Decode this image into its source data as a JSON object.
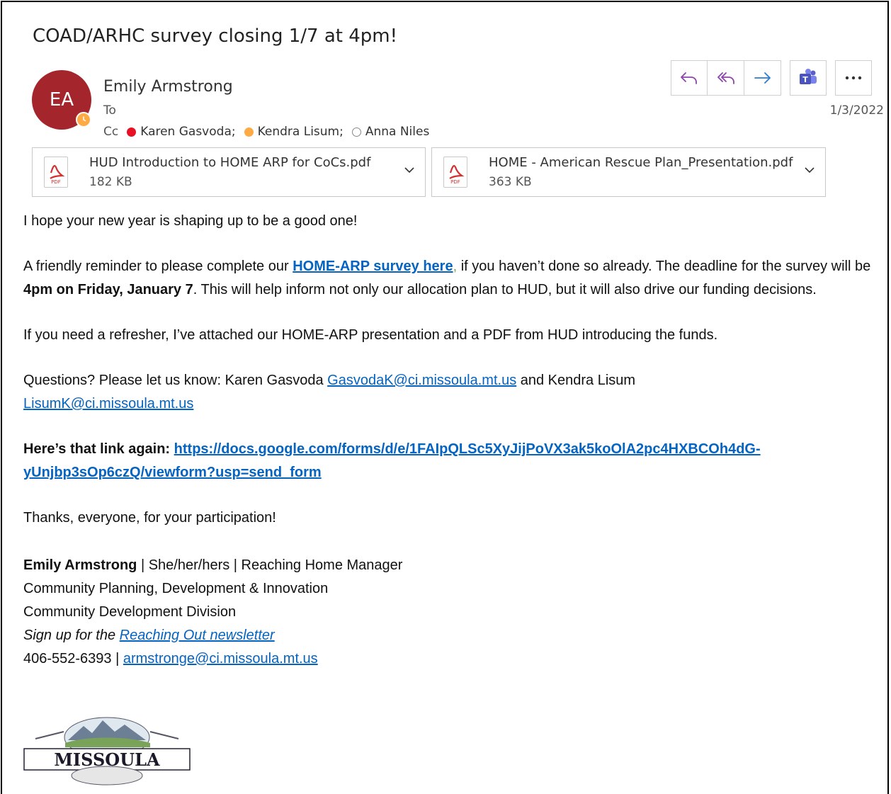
{
  "subject": "COAD/ARHC survey closing 1/7 at 4pm!",
  "sender": {
    "initials": "EA",
    "name": "Emily Armstrong",
    "avatar_color": "#a4262c",
    "presence_color": "#ffaa44"
  },
  "to_label": "To",
  "cc_label": "Cc",
  "cc": [
    {
      "name": "Karen Gasvoda;",
      "status": "busy",
      "color": "#e81123"
    },
    {
      "name": "Kendra Lisum;",
      "status": "away",
      "color": "#ffaa44"
    },
    {
      "name": "Anna Niles",
      "status": "offline",
      "color": "#ffffff"
    }
  ],
  "date": "1/3/2022",
  "toolbar": {
    "reply_icon": "reply-icon",
    "reply_all_icon": "reply-all-icon",
    "forward_icon": "forward-icon",
    "teams_icon": "teams-icon",
    "more_icon": "more-icon"
  },
  "attachments": [
    {
      "name": "HUD Introduction to HOME ARP for CoCs.pdf",
      "size": "182 KB",
      "type_label": "PDF"
    },
    {
      "name": "HOME - American Rescue Plan_Presentation.pdf",
      "size": "363 KB",
      "type_label": "PDF"
    }
  ],
  "body": {
    "greeting": "I hope your new year is shaping up to be a good one!",
    "reminder_pre": "A friendly reminder to please complete our ",
    "reminder_link": "HOME-ARP survey here",
    "reminder_comma": ",",
    "reminder_mid": " if you haven’t done so already. The deadline for the survey will be ",
    "reminder_deadline": "4pm on Friday, January 7",
    "reminder_post": ".  This will help inform not only our allocation plan to HUD, but it will also drive our funding decisions.",
    "refresher": "If you need a refresher, I’ve attached our HOME-ARP presentation and a PDF from HUD introducing the funds.",
    "questions_pre": "Questions? Please let us know: Karen Gasvoda ",
    "questions_email1": "GasvodaK@ci.missoula.mt.us",
    "questions_mid": " and Kendra Lisum ",
    "questions_email2": "LisumK@ci.missoula.mt.us",
    "link_again_label": "Here’s that link again: ",
    "link_url_line1": "https://docs.google.com/forms/d/e/1FAIpQLSc5XyJijPoVX3ak5koOlA2pc4HXBCOh4dG-",
    "link_url_line2": "yUnjbp3sOp6czQ/viewform?usp=send_form",
    "thanks": "Thanks, everyone, for your participation!"
  },
  "signature": {
    "name": "Emily Armstrong",
    "title_rest": " | She/her/hers | Reaching Home Manager",
    "dept": "Community Planning, Development & Innovation",
    "division": "Community Development Division",
    "newsletter_pre": "Sign up for the ",
    "newsletter_link": "Reaching Out newsletter",
    "phone": "406-552-6393 | ",
    "email": "armstronge@ci.missoula.mt.us",
    "logo_text": "MISSOULA"
  }
}
